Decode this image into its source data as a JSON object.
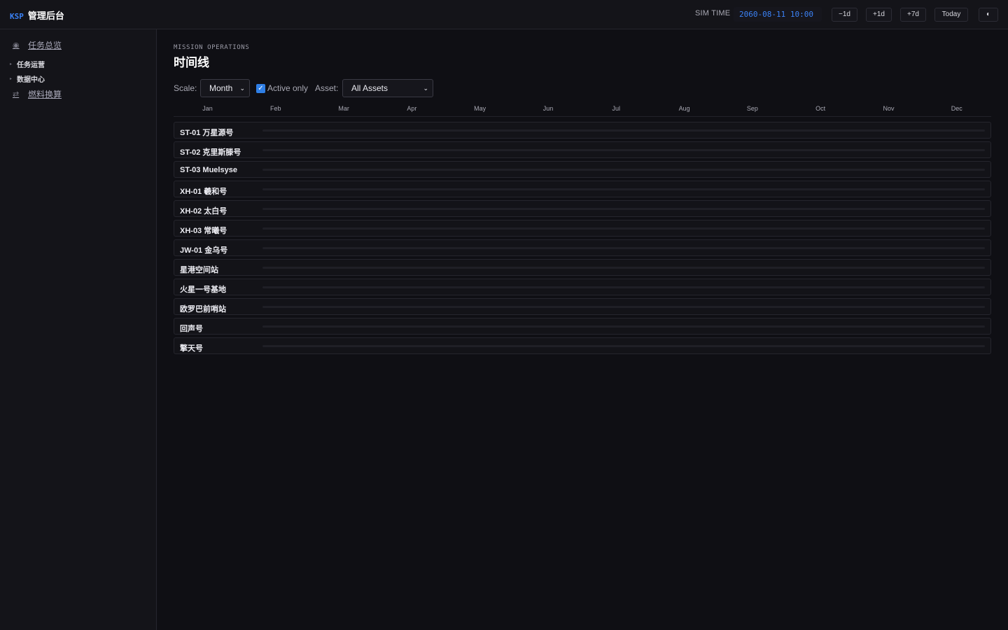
{
  "header": {
    "brand_prefix": "KSP",
    "brand_title": "管理后台",
    "sim_time_label": "SIM TIME",
    "sim_time_value": "2060-08-11 10:00",
    "buttons": [
      "−1d",
      "+1d",
      "+7d",
      "Today",
      "◐"
    ]
  },
  "sidebar": {
    "items": [
      {
        "type": "link",
        "icon": "◉",
        "label": "任务总览"
      },
      {
        "type": "group",
        "icon": "▸",
        "label": "任务运营"
      },
      {
        "type": "group",
        "icon": "▸",
        "label": "数据中心"
      },
      {
        "type": "link",
        "icon": "⇄",
        "label": "燃料换算"
      }
    ]
  },
  "page": {
    "eyebrow": "MISSION OPERATIONS",
    "title": "时间线"
  },
  "controls": {
    "scale_label": "Scale:",
    "scale_value": "Month",
    "active_only_label": "Active only",
    "active_only_checked": true,
    "asset_label": "Asset:",
    "asset_value": "All Assets",
    "chevron": "⌄",
    "check": "✓"
  },
  "timeline": {
    "months": [
      "Jan",
      "Feb",
      "Mar",
      "Apr",
      "May",
      "Jun",
      "Jul",
      "Aug",
      "Sep",
      "Oct",
      "Nov",
      "Dec"
    ],
    "assets": [
      "ST-01 万星源号",
      "ST-02 克里斯滕号",
      "ST-03 Muelsyse",
      "XH-01 羲和号",
      "XH-02 太白号",
      "XH-03 常曦号",
      "JW-01 金乌号",
      "星港空间站",
      "火星一号基地",
      "欧罗巴前哨站",
      "回声号",
      "擎天号"
    ]
  }
}
